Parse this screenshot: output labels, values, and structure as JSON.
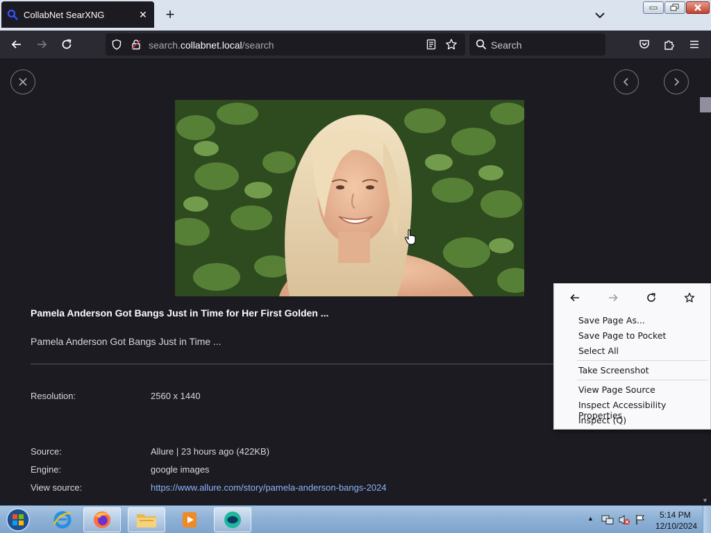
{
  "browser": {
    "tab": {
      "title": "CollabNet SearXNG"
    },
    "url": {
      "prefix": "search.",
      "host": "collabnet.local",
      "path": "/search"
    },
    "search_placeholder": "Search"
  },
  "result": {
    "title": "Pamela Anderson Got Bangs Just in Time for Her First Golden ...",
    "description": "Pamela Anderson Got Bangs Just in Time ...",
    "details": {
      "resolution_label": "Resolution:",
      "resolution_value": "2560 x 1440",
      "source_label": "Source:",
      "source_value": "Allure | 23 hours ago (422KB)",
      "engine_label": "Engine:",
      "engine_value": "google images",
      "view_source_label": "View source:",
      "view_source_url": "https://www.allure.com/story/pamela-anderson-bangs-2024"
    }
  },
  "context_menu": {
    "items": [
      "Save Page As...",
      "Save Page to Pocket",
      "Select All",
      "Take Screenshot",
      "View Page Source",
      "Inspect Accessibility Properties",
      "Inspect (Q)"
    ]
  },
  "taskbar": {
    "time": "5:14 PM",
    "date": "12/10/2024"
  },
  "colors": {
    "page_bg": "#1c1b22",
    "toolbar_bg": "#2b2a33",
    "link": "#8ab4f8",
    "tabstrip_bg": "#dbe3ee"
  }
}
